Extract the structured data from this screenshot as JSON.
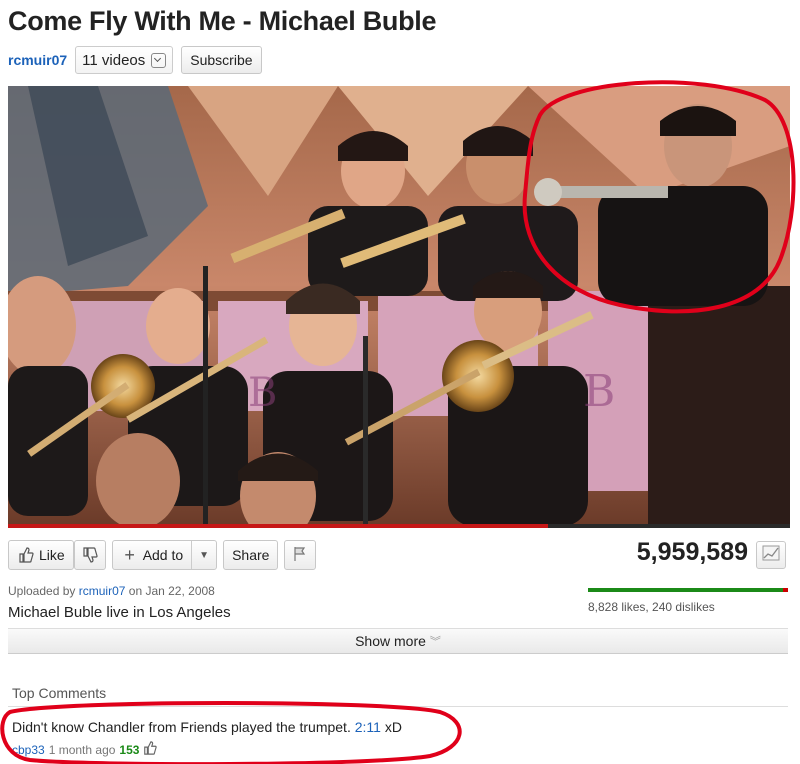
{
  "video": {
    "title": "Come Fly With Me - Michael Buble",
    "channel": "rcmuir07",
    "video_count": "11 videos",
    "subscribe_label": "Subscribe",
    "progress_fraction": 0.69
  },
  "actions": {
    "like_label": "Like",
    "add_to_label": "Add to",
    "share_label": "Share",
    "view_count": "5,959,589"
  },
  "details": {
    "uploaded_prefix": "Uploaded by",
    "uploader": "rcmuir07",
    "uploaded_date": "on Jan 22, 2008",
    "description": "Michael Buble live in Los Angeles",
    "likes_text": "8,828 likes, 240 dislikes",
    "likes_fraction": 0.974,
    "show_more_label": "Show more"
  },
  "comments": {
    "heading": "Top Comments",
    "items": [
      {
        "text_before": "Didn't know Chandler from Friends played the trumpet.",
        "timestamp": "2:11",
        "text_after": "xD",
        "user": "cbp33",
        "age": "1 month ago",
        "score": "153"
      }
    ]
  },
  "colors": {
    "accent_link": "#1c62b9",
    "like_green": "#1b8a18",
    "dislike_red": "#cc0000",
    "annotation_red": "#e0001a"
  }
}
